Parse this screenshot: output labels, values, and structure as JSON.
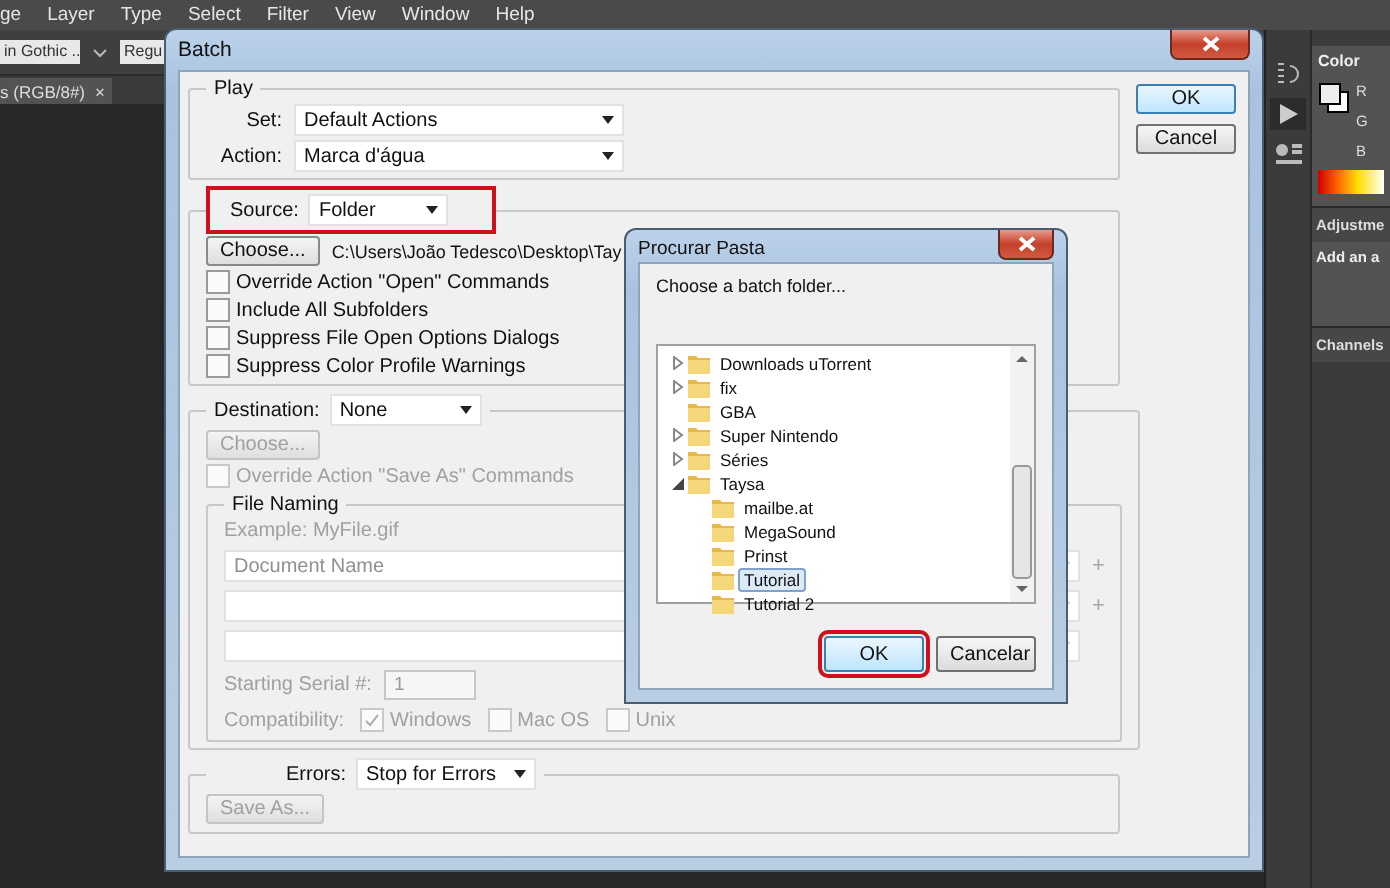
{
  "app_menu": [
    "ge",
    "Layer",
    "Type",
    "Select",
    "Filter",
    "View",
    "Window",
    "Help"
  ],
  "options_bar": {
    "font_family": "in Gothic ...",
    "font_style": "Regu"
  },
  "document_tab": {
    "title": "s (RGB/8#)",
    "close": "×"
  },
  "batch": {
    "title": "Batch",
    "play": {
      "title": "Play",
      "set_label": "Set:",
      "set_value": "Default Actions",
      "action_label": "Action:",
      "action_value": "Marca d'água"
    },
    "source": {
      "label": "Source:",
      "value": "Folder",
      "highlighted": true,
      "choose": {
        "label": "Choose...",
        "disabled": false
      },
      "path": "C:\\Users\\João Tedesco\\Desktop\\Tay",
      "options": [
        {
          "label": "Override Action \"Open\" Commands",
          "checked": false
        },
        {
          "label": "Include All Subfolders",
          "checked": false
        },
        {
          "label": "Suppress File Open Options Dialogs",
          "checked": false
        },
        {
          "label": "Suppress Color Profile Warnings",
          "checked": false
        }
      ]
    },
    "destination": {
      "label": "Destination:",
      "value": "None",
      "choose": {
        "label": "Choose...",
        "disabled": true
      },
      "override": {
        "label": "Override Action \"Save As\" Commands",
        "checked": false,
        "disabled": true
      }
    },
    "file_naming": {
      "title": "File Naming",
      "disabled": true,
      "example": "Example: MyFile.gif",
      "fields": [
        {
          "kind": "with_add",
          "value": "Document Name",
          "add": "+"
        },
        {
          "kind": "with_add",
          "add": "+"
        },
        {
          "kind": "plain"
        }
      ],
      "serial_label": "Starting Serial #:",
      "serial_value": "1",
      "compat_label": "Compatibility:",
      "compat": [
        {
          "label": "Windows",
          "checked": true
        },
        {
          "label": "Mac OS",
          "checked": false
        },
        {
          "label": "Unix",
          "checked": false
        }
      ]
    },
    "errors": {
      "label": "Errors:",
      "value": "Stop for Errors",
      "save_as": {
        "label": "Save As...",
        "disabled": true
      }
    },
    "buttons": [
      {
        "label": "OK",
        "default": true
      },
      {
        "label": "Cancel",
        "default": false
      }
    ]
  },
  "folder_dialog": {
    "title": "Procurar Pasta",
    "prompt": "Choose a batch folder...",
    "tree": [
      {
        "name": "Downloads uTorrent",
        "expanded": false,
        "selected": false
      },
      {
        "name": "fix",
        "expanded": false,
        "selected": false
      },
      {
        "name": "GBA",
        "selected": false
      },
      {
        "name": "Super Nintendo",
        "expanded": false,
        "selected": false
      },
      {
        "name": "Séries",
        "expanded": false,
        "selected": false
      },
      {
        "name": "Taysa",
        "expanded": true,
        "selected": false,
        "children": [
          {
            "name": "mailbe.at",
            "selected": false
          },
          {
            "name": "MegaSound",
            "selected": false
          },
          {
            "name": "Prinst",
            "selected": false
          },
          {
            "name": "Tutorial",
            "selected": true
          },
          {
            "name": "Tutorial 2",
            "selected": false
          }
        ]
      }
    ],
    "buttons": [
      {
        "label": "OK",
        "highlighted": true,
        "default": true
      },
      {
        "label": "Cancelar",
        "highlighted": false,
        "default": false
      }
    ]
  },
  "right_panel": {
    "color_tab": "Color",
    "channels": [
      "R",
      "G",
      "B"
    ],
    "adjustments_title": "Adjustme",
    "adjustments_hint": "Add an a",
    "channels_tab": "Channels"
  }
}
